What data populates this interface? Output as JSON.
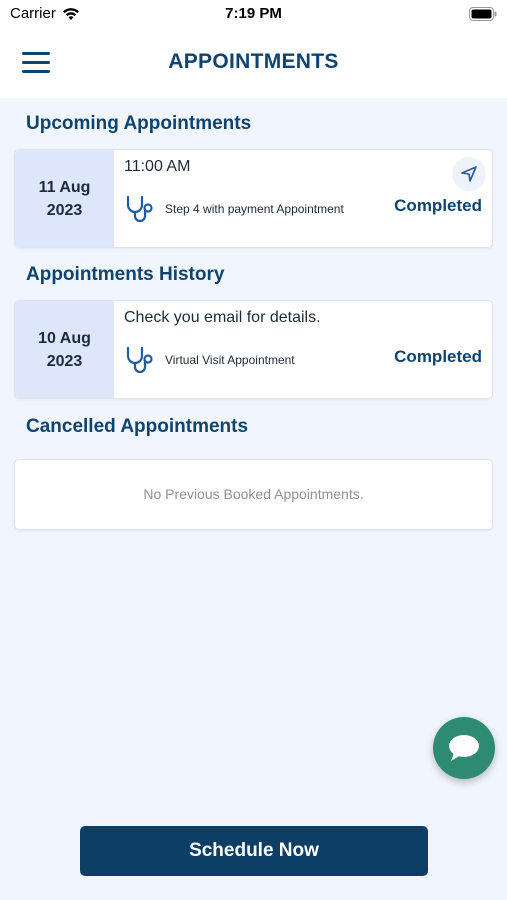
{
  "status_bar": {
    "carrier": "Carrier",
    "time": "7:19 PM",
    "wifi_icon": "wifi-icon",
    "battery_icon": "battery-icon"
  },
  "header": {
    "title": "APPOINTMENTS",
    "menu_icon": "hamburger-menu-icon"
  },
  "sections": {
    "upcoming": {
      "title": "Upcoming Appointments",
      "card": {
        "date_line1": "11 Aug",
        "date_line2": "2023",
        "time": "11:00 AM",
        "type": "Step 4 with payment Appointment",
        "status": "Completed",
        "icon": "stethoscope-icon",
        "action_icon": "navigation-arrow-icon"
      }
    },
    "history": {
      "title": "Appointments History",
      "card": {
        "date_line1": "10 Aug",
        "date_line2": "2023",
        "note": "Check you email for details.",
        "type": "Virtual Visit Appointment",
        "status": "Completed",
        "icon": "stethoscope-icon"
      }
    },
    "cancelled": {
      "title": "Cancelled Appointments",
      "empty_text": "No Previous Booked Appointments."
    }
  },
  "chat_button": {
    "icon": "chat-bubble-icon"
  },
  "schedule_button": {
    "label": "Schedule Now"
  },
  "colors": {
    "primary": "#0f4470",
    "background": "#f1f5fd",
    "date_box": "#dde6fa",
    "chat": "#2f8a72",
    "button": "#0d3f66"
  }
}
